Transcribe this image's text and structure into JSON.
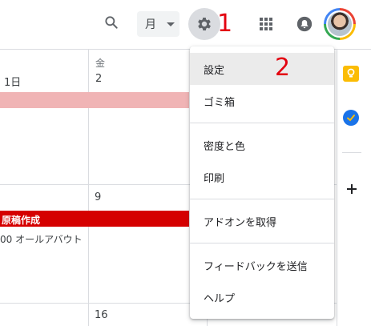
{
  "header": {
    "view_label": "月",
    "annotation_gear": "1",
    "annotation_settings": "2"
  },
  "calendar": {
    "day_headers": [
      {
        "dow": "",
        "date": "1日"
      },
      {
        "dow": "金",
        "date": "2"
      }
    ],
    "week_dates": [
      "9",
      "16"
    ],
    "events": {
      "red_bar": "原稿作成",
      "timed": "00 オールアバウト"
    }
  },
  "menu": {
    "group1": [
      "設定",
      "ゴミ箱"
    ],
    "group2": [
      "密度と色",
      "印刷"
    ],
    "group3": [
      "アドオンを取得"
    ],
    "group4": [
      "フィードバックを送信",
      "ヘルプ"
    ]
  },
  "colors": {
    "accent_red": "#d50000",
    "event_pink": "#f0b4b5",
    "annotation": "#e3000f",
    "keep_yellow": "#fbbc04",
    "tasks_blue": "#1a73e8"
  },
  "icons": [
    "search-icon",
    "chevron-down-icon",
    "gear-icon",
    "apps-grid-icon",
    "bell-icon",
    "avatar",
    "keep-icon",
    "tasks-icon",
    "plus-icon"
  ]
}
